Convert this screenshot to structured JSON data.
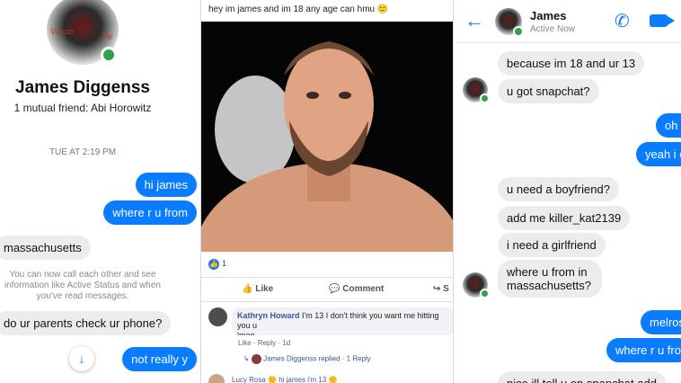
{
  "left_panel": {
    "avatar_text_left": "Vasuo",
    "avatar_text_right": "Pe",
    "name": "James Diggenss",
    "mutual": "1 mutual friend: Abi Horowitz",
    "timestamp": "TUE AT 2:19 PM",
    "messages": [
      {
        "dir": "out",
        "text": "hi james"
      },
      {
        "dir": "out",
        "text": "where r u from"
      },
      {
        "dir": "in",
        "text": "massachusetts"
      },
      {
        "dir": "in",
        "text": "do ur parents check ur phone?"
      },
      {
        "dir": "out",
        "text": "not really y"
      }
    ],
    "notice": "You can now call each other and see information like Active Status and when you've read messages.",
    "scroll_icon": "arrow-down-icon"
  },
  "middle_panel": {
    "post_text": "hey im james and im 18 any age can hmu 🙂",
    "reaction_count": "1",
    "actions": {
      "like": "Like",
      "comment": "Comment",
      "share": "S"
    },
    "comment": {
      "author": "Kathryn Howard",
      "text": "I'm 13 I don't think you want me hitting you u",
      "text2": "lmao",
      "meta": "Like · Reply · 1d"
    },
    "reply_summary": {
      "name": "James Diggenss",
      "suffix": "replied · 1 Reply"
    },
    "comment2_preview": "Lucy Rosa 🙂 hi james i'm 13 🙂"
  },
  "right_panel": {
    "name": "James",
    "status": "Active Now",
    "messages": [
      {
        "dir": "in",
        "text": "because im 18 and ur 13"
      },
      {
        "dir": "in",
        "text": "u got snapchat?"
      },
      {
        "dir": "out",
        "text": "oh o"
      },
      {
        "dir": "out",
        "text": "yeah i c"
      },
      {
        "dir": "in",
        "text": "u need a boyfriend?"
      },
      {
        "dir": "in",
        "text": "add me killer_kat2139"
      },
      {
        "dir": "in",
        "text": "i need a girlfriend"
      },
      {
        "dir": "in",
        "text": "where u from in massachusetts?"
      },
      {
        "dir": "out",
        "text": "melros"
      },
      {
        "dir": "out",
        "text": "where r u fro"
      },
      {
        "dir": "in",
        "text": "nice ill tell u on snapchat add"
      }
    ]
  },
  "colors": {
    "messenger_blue": "#0a7cff",
    "bubble_gray": "#ececec",
    "online_green": "#31a24c",
    "fb_blue": "#385898"
  }
}
